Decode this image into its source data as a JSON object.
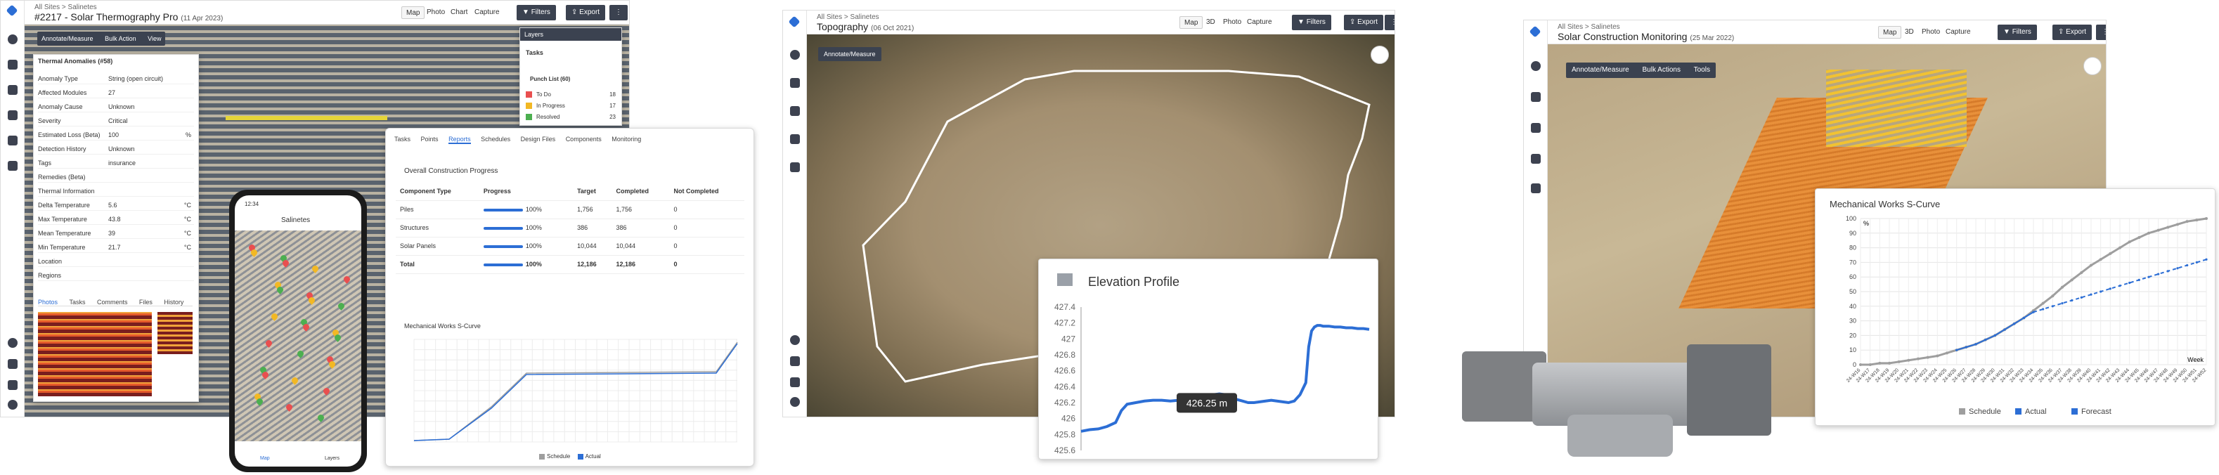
{
  "app1": {
    "breadcrumb": [
      "All Sites",
      "Salinetes"
    ],
    "title": "#2217 - Solar Thermography Pro",
    "title_date": "(11 Apr 2023)",
    "view_tabs": [
      "Map",
      "Photo",
      "Chart",
      "Capture"
    ],
    "filters_label": "Filters",
    "export_label": "Export",
    "toolbar": [
      "Annotate/Measure",
      "Bulk Action",
      "View"
    ],
    "details": {
      "header": "Thermal Anomalies (#58)",
      "fields": [
        {
          "label": "Anomaly Type",
          "value": "String (open circuit)",
          "unit": ""
        },
        {
          "label": "Affected Modules",
          "value": "27",
          "unit": ""
        },
        {
          "label": "Anomaly Cause",
          "value": "Unknown",
          "unit": ""
        },
        {
          "label": "Severity",
          "value": "Critical",
          "unit": ""
        },
        {
          "label": "Estimated Loss (Beta)",
          "value": "100",
          "unit": "%"
        },
        {
          "label": "Detection History",
          "value": "Unknown",
          "unit": ""
        },
        {
          "label": "Tags",
          "value": "insurance",
          "unit": ""
        },
        {
          "label": "Remedies (Beta)",
          "value": "",
          "unit": ""
        },
        {
          "label": "Thermal Information",
          "value": "",
          "unit": ""
        },
        {
          "label": "Delta Temperature",
          "value": "5.6",
          "unit": "°C"
        },
        {
          "label": "Max Temperature",
          "value": "43.8",
          "unit": "°C"
        },
        {
          "label": "Mean Temperature",
          "value": "39",
          "unit": "°C"
        },
        {
          "label": "Min Temperature",
          "value": "21.7",
          "unit": "°C"
        },
        {
          "label": "Location",
          "value": "",
          "unit": ""
        },
        {
          "label": "Regions",
          "value": "",
          "unit": ""
        }
      ],
      "tabs": [
        "Photos",
        "Tasks",
        "Comments",
        "Files",
        "History"
      ]
    },
    "layers": {
      "header": "Layers",
      "tasks_label": "Tasks",
      "punch_list": "Punch List (60)",
      "items": [
        {
          "label": "To Do",
          "count": "18",
          "color": "#e94f4f"
        },
        {
          "label": "In Progress",
          "count": "17",
          "color": "#f2b824"
        },
        {
          "label": "Resolved",
          "count": "23",
          "color": "#4caf50"
        }
      ]
    }
  },
  "reports": {
    "tabs": [
      "Tasks",
      "Points",
      "Reports",
      "Schedules",
      "Design Files",
      "Components",
      "Monitoring"
    ],
    "section_title": "Overall Construction Progress",
    "columns": [
      "Component Type",
      "Progress",
      "Target",
      "Completed",
      "Not Completed"
    ],
    "rows": [
      {
        "type": "Piles",
        "progress": "100%",
        "target": "1,756",
        "completed": "1,756",
        "not_completed": "0"
      },
      {
        "type": "Structures",
        "progress": "100%",
        "target": "386",
        "completed": "386",
        "not_completed": "0"
      },
      {
        "type": "Solar Panels",
        "progress": "100%",
        "target": "10,044",
        "completed": "10,044",
        "not_completed": "0"
      },
      {
        "type": "Total",
        "progress": "100%",
        "target": "12,186",
        "completed": "12,186",
        "not_completed": "0"
      }
    ],
    "curve_title": "Mechanical Works S-Curve",
    "legend": [
      "Schedule",
      "Actual"
    ]
  },
  "phone": {
    "time": "12:34",
    "site": "Salinetes",
    "nav": [
      "Map",
      "Layers"
    ]
  },
  "app2": {
    "breadcrumb": [
      "All Sites",
      "Salinetes"
    ],
    "title": "Topography",
    "title_date": "(06 Oct 2021)",
    "view_tabs": [
      "Map",
      "3D",
      "Photo",
      "Capture"
    ],
    "filters_label": "Filters",
    "export_label": "Export",
    "toolbar": [
      "Annotate/Measure"
    ],
    "elevation": {
      "title": "Elevation Profile",
      "tooltip": "426.25 m",
      "chart_data": {
        "type": "line",
        "title": "Elevation Profile",
        "yticks": [
          427.4,
          427.2,
          427.0,
          426.8,
          426.6,
          426.4,
          426.2,
          426.0,
          425.8,
          425.6
        ],
        "ylim": [
          425.6,
          427.4
        ],
        "x": [
          0,
          3,
          6,
          9,
          12,
          14,
          16,
          19,
          22,
          25,
          28,
          31,
          34,
          37,
          40,
          42,
          44,
          46,
          48,
          50,
          52,
          54,
          56,
          58,
          60,
          62,
          64,
          66,
          68,
          70,
          72,
          74,
          76,
          78,
          79,
          80,
          81,
          82,
          83,
          84,
          86,
          88,
          90,
          92,
          94,
          96,
          98,
          100
        ],
        "y": [
          425.84,
          425.86,
          425.87,
          425.9,
          425.95,
          426.1,
          426.18,
          426.2,
          426.22,
          426.23,
          426.23,
          426.22,
          426.23,
          426.24,
          426.25,
          426.26,
          426.28,
          426.3,
          426.31,
          426.3,
          426.27,
          426.24,
          426.22,
          426.2,
          426.2,
          426.21,
          426.22,
          426.23,
          426.22,
          426.21,
          426.2,
          426.22,
          426.3,
          426.45,
          426.9,
          427.1,
          427.15,
          427.17,
          427.17,
          427.16,
          427.16,
          427.15,
          427.15,
          427.14,
          427.14,
          427.13,
          427.13,
          427.12
        ]
      }
    }
  },
  "app3": {
    "breadcrumb": [
      "All Sites",
      "Salinetes"
    ],
    "title": "Solar Construction Monitoring",
    "title_date": "(25 Mar 2022)",
    "view_tabs": [
      "Map",
      "3D",
      "Photo",
      "Capture"
    ],
    "filters_label": "Filters",
    "export_label": "Export",
    "toolbar": [
      "Annotate/Measure",
      "Bulk Actions",
      "Tools"
    ],
    "scurve": {
      "title": "Mechanical Works S-Curve",
      "chart_data": {
        "type": "line",
        "title": "Mechanical Works S-Curve",
        "xlabel": "Week",
        "ylabel": "%",
        "ylim": [
          0,
          100
        ],
        "yticks": [
          0,
          10,
          20,
          30,
          40,
          50,
          60,
          70,
          80,
          90,
          100
        ],
        "categories": [
          "24-W16",
          "24-W17",
          "24-W18",
          "24-W19",
          "24-W20",
          "24-W21",
          "24-W22",
          "24-W23",
          "24-W24",
          "24-W25",
          "24-W26",
          "24-W27",
          "24-W28",
          "24-W29",
          "24-W30",
          "24-W31",
          "24-W32",
          "24-W33",
          "24-W34",
          "24-W35",
          "24-W36",
          "24-W37",
          "24-W38",
          "24-W39",
          "24-W40",
          "24-W41",
          "24-W42",
          "24-W43",
          "24-W44",
          "24-W45",
          "24-W46",
          "24-W47",
          "24-W48",
          "24-W49",
          "24-W50",
          "24-W51",
          "24-W52"
        ],
        "series": [
          {
            "name": "Schedule",
            "values": [
              0,
              0,
              1,
              1,
              2,
              3,
              4,
              5,
              6,
              8,
              10,
              12,
              14,
              17,
              20,
              24,
              28,
              32,
              37,
              42,
              47,
              53,
              58,
              63,
              68,
              72,
              76,
              80,
              84,
              87,
              90,
              92,
              94,
              96,
              98,
              99,
              100
            ]
          },
          {
            "name": "Actual",
            "values": [
              null,
              null,
              null,
              null,
              null,
              null,
              null,
              null,
              null,
              null,
              10,
              12,
              14,
              17,
              20,
              24,
              28,
              32,
              36,
              null,
              null,
              null,
              null,
              null,
              null,
              null,
              null,
              null,
              null,
              null,
              null,
              null,
              null,
              null,
              null,
              null,
              null
            ]
          },
          {
            "name": "Forecast",
            "values": [
              null,
              null,
              null,
              null,
              null,
              null,
              null,
              null,
              null,
              null,
              null,
              null,
              null,
              null,
              null,
              null,
              null,
              null,
              36,
              38,
              40,
              42,
              44,
              46,
              48,
              50,
              52,
              54,
              56,
              58,
              60,
              62,
              64,
              66,
              68,
              70,
              72
            ]
          }
        ],
        "colors": [
          "#9e9e9e",
          "#2c6ed5",
          "#2c6ed5"
        ]
      }
    }
  },
  "colors": {
    "accent": "#2c6ed5",
    "dark": "#3b4250",
    "orange": "#e8903a"
  }
}
